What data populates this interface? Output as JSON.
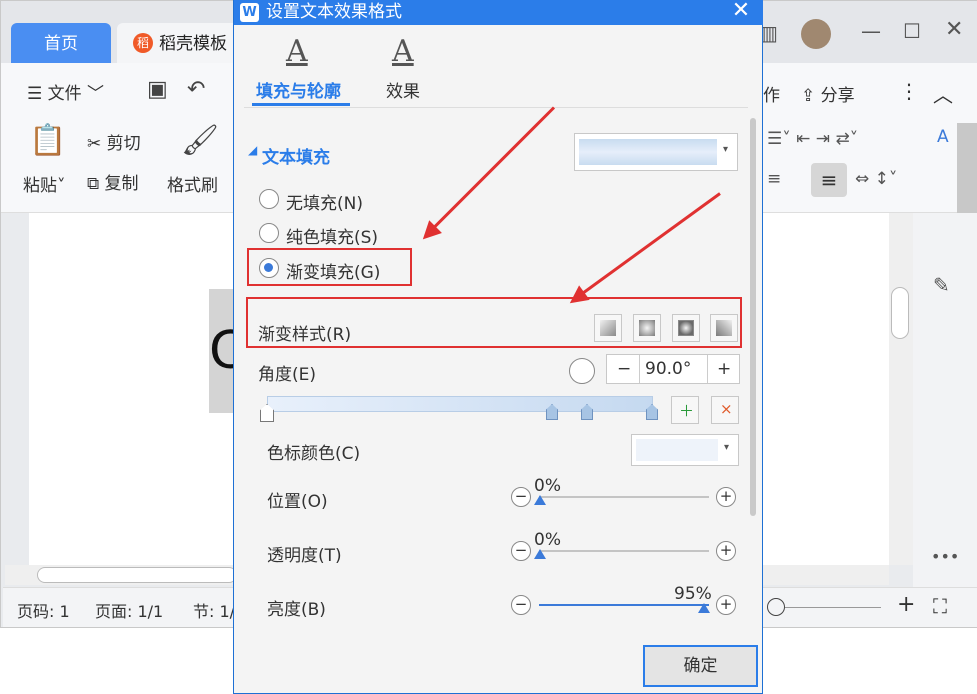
{
  "app": {
    "tabs": [
      {
        "label": "首页"
      },
      {
        "label": "稻壳模板"
      }
    ],
    "menu": {
      "file": "文件",
      "share": "分享",
      "work": "作"
    },
    "ribbon": {
      "paste": "粘贴",
      "cut": "剪切",
      "copy": "复制",
      "format_painter": "格式刷"
    },
    "document": {
      "visible_char": "C"
    },
    "status": {
      "page_code": "页码: 1",
      "page": "页面: 1/1",
      "section": "节: 1/"
    }
  },
  "dialog": {
    "title": "设置文本效果格式",
    "tabs": [
      {
        "label": "填充与轮廓"
      },
      {
        "label": "效果"
      }
    ],
    "text_fill": {
      "section_label": "文本填充",
      "options": [
        {
          "label": "无填充(N)",
          "selected": false
        },
        {
          "label": "纯色填充(S)",
          "selected": false
        },
        {
          "label": "渐变填充(G)",
          "selected": true
        }
      ]
    },
    "gradient_style": {
      "label": "渐变样式(R)"
    },
    "angle": {
      "label": "角度(E)",
      "value": "90.0°",
      "minus": "−",
      "plus": "+"
    },
    "stop_color": {
      "label": "色标颜色(C)"
    },
    "position": {
      "label": "位置(O)",
      "value": "0%"
    },
    "transparency": {
      "label": "透明度(T)",
      "value": "0%"
    },
    "brightness": {
      "label": "亮度(B)",
      "value": "95%"
    },
    "ok": "确定",
    "colors": {
      "accent": "#2b7de9",
      "highlight": "#e03131"
    }
  }
}
